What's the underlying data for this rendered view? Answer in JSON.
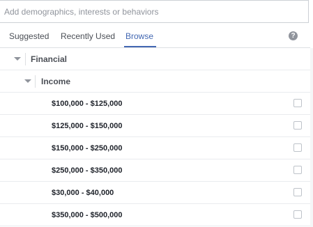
{
  "search": {
    "placeholder": "Add demographics, interests or behaviors",
    "value": ""
  },
  "tabs": [
    {
      "label": "Suggested",
      "active": false
    },
    {
      "label": "Recently Used",
      "active": false
    },
    {
      "label": "Browse",
      "active": true
    }
  ],
  "help_icon": {
    "icon": "question-circle-icon",
    "glyph": "?"
  },
  "tree": {
    "category": {
      "label": "Financial",
      "expanded": true
    },
    "subcategory": {
      "label": "Income",
      "expanded": true
    },
    "options": [
      {
        "label": "$100,000 - $125,000",
        "checked": false
      },
      {
        "label": "$125,000 - $150,000",
        "checked": false
      },
      {
        "label": "$150,000 - $250,000",
        "checked": false
      },
      {
        "label": "$250,000 - $350,000",
        "checked": false
      },
      {
        "label": "$30,000 - $40,000",
        "checked": false
      },
      {
        "label": "$350,000 - $500,000",
        "checked": false
      }
    ]
  },
  "colors": {
    "accent": "#4267b2",
    "text": "#1d2129",
    "muted": "#90949c",
    "border": "#dddfe2"
  }
}
